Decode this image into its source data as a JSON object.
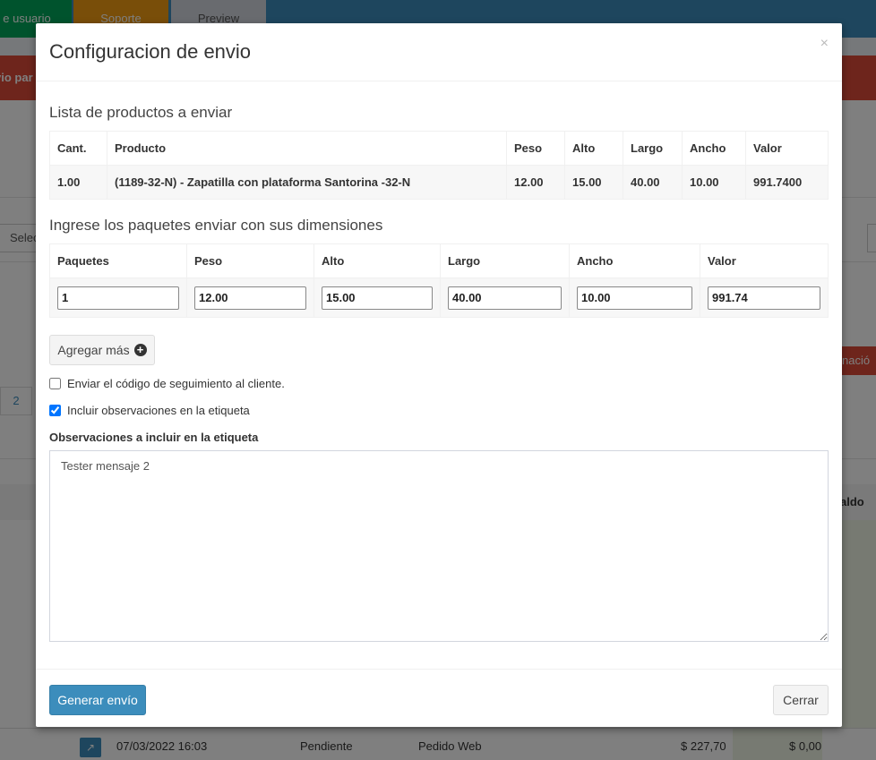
{
  "background": {
    "nav_tabs": [
      "e usuario",
      "Soporte",
      "Preview"
    ],
    "red_bar_text": "vio par",
    "select_text": "Selec",
    "pagination_page": "2",
    "red_button_text": "nació",
    "table_header_right": "aldo",
    "row": {
      "date": "07/03/2022 16:03",
      "status": "Pendiente",
      "type": "Pedido Web",
      "total": "$ 227,70",
      "balance": "$ 0,00"
    }
  },
  "modal": {
    "title": "Configuracion de envio",
    "close_symbol": "×",
    "products_section": {
      "title": "Lista de productos a enviar",
      "columns": [
        "Cant.",
        "Producto",
        "Peso",
        "Alto",
        "Largo",
        "Ancho",
        "Valor"
      ],
      "rows": [
        [
          "1.00",
          "(1189-32-N) - Zapatilla con plataforma Santorina -32-N",
          "12.00",
          "15.00",
          "40.00",
          "10.00",
          "991.7400"
        ]
      ]
    },
    "packages_section": {
      "title": "Ingrese los paquetes enviar con sus dimensiones",
      "columns": [
        "Paquetes",
        "Peso",
        "Alto",
        "Largo",
        "Ancho",
        "Valor"
      ],
      "rows": [
        [
          "1",
          "12.00",
          "15.00",
          "40.00",
          "10.00",
          "991.74"
        ]
      ]
    },
    "add_more_label": "Agregar más",
    "checkbox_tracking": {
      "label": "Enviar el código de seguimiento al cliente.",
      "checked": false
    },
    "checkbox_observations": {
      "label": "Incluir observaciones en la etiqueta",
      "checked": true
    },
    "observations_label": "Observaciones a incluir en la etiqueta",
    "observations_value": "Tester mensaje 2",
    "footer": {
      "generate_label": "Generar envío",
      "close_label": "Cerrar"
    }
  },
  "colors": {
    "primary": "#3c8dbc",
    "danger": "#dd4b39",
    "success": "#00a65a",
    "warning": "#f39c12"
  }
}
